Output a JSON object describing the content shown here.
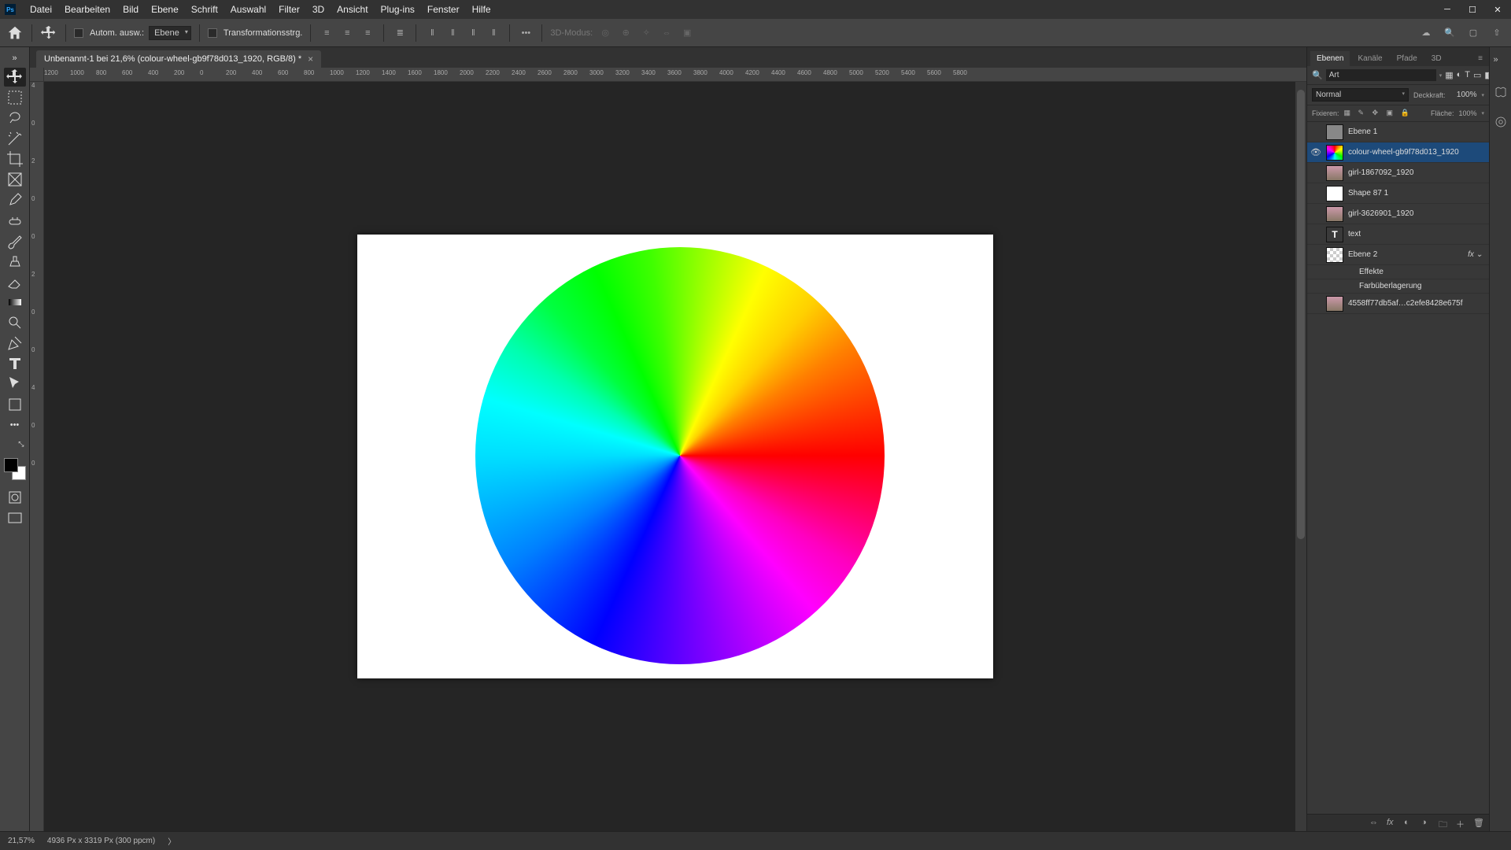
{
  "menu": {
    "file": "Datei",
    "edit": "Bearbeiten",
    "image": "Bild",
    "layer": "Ebene",
    "type": "Schrift",
    "select": "Auswahl",
    "filter": "Filter",
    "threeD": "3D",
    "view": "Ansicht",
    "plugins": "Plug-ins",
    "window": "Fenster",
    "help": "Hilfe"
  },
  "options": {
    "autoSel": "Autom. ausw.:",
    "layerTarget": "Ebene",
    "transform": "Transformationsstrg.",
    "modeDisabled": "3D-Modus:"
  },
  "document": {
    "tab": "Unbenannt-1 bei 21,6% (colour-wheel-gb9f78d013_1920, RGB/8) *"
  },
  "ruler": {
    "marks": [
      "1200",
      "1000",
      "800",
      "600",
      "400",
      "200",
      "0",
      "200",
      "400",
      "600",
      "800",
      "1000",
      "1200",
      "1400",
      "1600",
      "1800",
      "2000",
      "2200",
      "2400",
      "2600",
      "2800",
      "3000",
      "3200",
      "3400",
      "3600",
      "3800",
      "4000",
      "4200",
      "4400",
      "4600",
      "4800",
      "5000",
      "5200",
      "5400",
      "5600",
      "5800"
    ],
    "vmarks": [
      "4",
      "0",
      "2",
      "0",
      "0",
      "2",
      "0",
      "0",
      "4",
      "0",
      "0"
    ]
  },
  "panelTabs": {
    "layers": "Ebenen",
    "channels": "Kanäle",
    "paths": "Pfade",
    "threeD": "3D"
  },
  "layerPanel": {
    "searchLabel": "Art",
    "blendMode": "Normal",
    "opacityLabel": "Deckkraft:",
    "opacityVal": "100%",
    "fillLabel": "Fläche:",
    "fillVal": "100%",
    "lockLabel": "Fixieren:"
  },
  "layers": [
    {
      "name": "Ebene 1",
      "thumb": "solid",
      "visible": false
    },
    {
      "name": "colour-wheel-gb9f78d013_1920",
      "thumb": "wheel",
      "visible": true,
      "selected": true
    },
    {
      "name": "girl-1867092_1920",
      "thumb": "img",
      "visible": false
    },
    {
      "name": "Shape 87 1",
      "thumb": "shape",
      "visible": false
    },
    {
      "name": "girl-3626901_1920",
      "thumb": "img",
      "visible": false
    },
    {
      "name": "text",
      "thumb": "text",
      "visible": false
    },
    {
      "name": "Ebene 2",
      "thumb": "check",
      "visible": false,
      "fx": true
    },
    {
      "name": "Effekte",
      "effect": true
    },
    {
      "name": "Farbüberlagerung",
      "effect": true
    },
    {
      "name": "4558ff77db5af…c2efe8428e675f",
      "thumb": "img",
      "visible": false
    }
  ],
  "status": {
    "zoom": "21,57%",
    "dim": "4936 Px x 3319 Px (300 ppcm)"
  }
}
